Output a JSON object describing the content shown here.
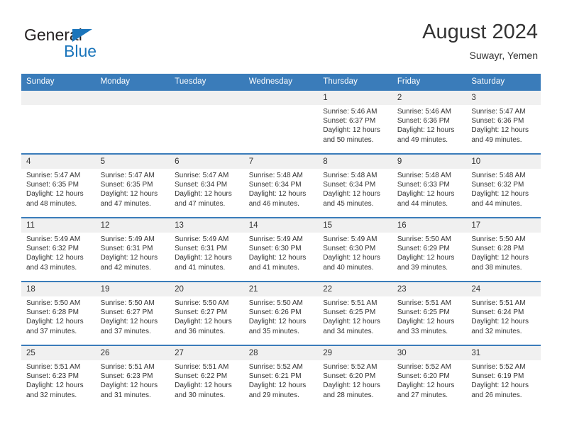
{
  "brand": {
    "name_top": "General",
    "name_bottom": "Blue",
    "color_blue": "#1b75bb",
    "color_dark": "#231f20"
  },
  "header": {
    "title": "August 2024",
    "subtitle": "Suwayr, Yemen"
  },
  "theme": {
    "header_row_bg": "#3a7cba",
    "daynum_bg": "#f0f0f0",
    "text": "#333333"
  },
  "weekday_headers": [
    "Sunday",
    "Monday",
    "Tuesday",
    "Wednesday",
    "Thursday",
    "Friday",
    "Saturday"
  ],
  "labels": {
    "sunrise_prefix": "Sunrise:",
    "sunset_prefix": "Sunset:",
    "daylight_prefix": "Daylight:"
  },
  "weeks": [
    [
      {
        "day": "",
        "empty": true
      },
      {
        "day": "",
        "empty": true
      },
      {
        "day": "",
        "empty": true
      },
      {
        "day": "",
        "empty": true
      },
      {
        "day": "1",
        "sunrise": "Sunrise: 5:46 AM",
        "sunset": "Sunset: 6:37 PM",
        "daylight": "Daylight: 12 hours and 50 minutes."
      },
      {
        "day": "2",
        "sunrise": "Sunrise: 5:46 AM",
        "sunset": "Sunset: 6:36 PM",
        "daylight": "Daylight: 12 hours and 49 minutes."
      },
      {
        "day": "3",
        "sunrise": "Sunrise: 5:47 AM",
        "sunset": "Sunset: 6:36 PM",
        "daylight": "Daylight: 12 hours and 49 minutes."
      }
    ],
    [
      {
        "day": "4",
        "sunrise": "Sunrise: 5:47 AM",
        "sunset": "Sunset: 6:35 PM",
        "daylight": "Daylight: 12 hours and 48 minutes."
      },
      {
        "day": "5",
        "sunrise": "Sunrise: 5:47 AM",
        "sunset": "Sunset: 6:35 PM",
        "daylight": "Daylight: 12 hours and 47 minutes."
      },
      {
        "day": "6",
        "sunrise": "Sunrise: 5:47 AM",
        "sunset": "Sunset: 6:34 PM",
        "daylight": "Daylight: 12 hours and 47 minutes."
      },
      {
        "day": "7",
        "sunrise": "Sunrise: 5:48 AM",
        "sunset": "Sunset: 6:34 PM",
        "daylight": "Daylight: 12 hours and 46 minutes."
      },
      {
        "day": "8",
        "sunrise": "Sunrise: 5:48 AM",
        "sunset": "Sunset: 6:34 PM",
        "daylight": "Daylight: 12 hours and 45 minutes."
      },
      {
        "day": "9",
        "sunrise": "Sunrise: 5:48 AM",
        "sunset": "Sunset: 6:33 PM",
        "daylight": "Daylight: 12 hours and 44 minutes."
      },
      {
        "day": "10",
        "sunrise": "Sunrise: 5:48 AM",
        "sunset": "Sunset: 6:32 PM",
        "daylight": "Daylight: 12 hours and 44 minutes."
      }
    ],
    [
      {
        "day": "11",
        "sunrise": "Sunrise: 5:49 AM",
        "sunset": "Sunset: 6:32 PM",
        "daylight": "Daylight: 12 hours and 43 minutes."
      },
      {
        "day": "12",
        "sunrise": "Sunrise: 5:49 AM",
        "sunset": "Sunset: 6:31 PM",
        "daylight": "Daylight: 12 hours and 42 minutes."
      },
      {
        "day": "13",
        "sunrise": "Sunrise: 5:49 AM",
        "sunset": "Sunset: 6:31 PM",
        "daylight": "Daylight: 12 hours and 41 minutes."
      },
      {
        "day": "14",
        "sunrise": "Sunrise: 5:49 AM",
        "sunset": "Sunset: 6:30 PM",
        "daylight": "Daylight: 12 hours and 41 minutes."
      },
      {
        "day": "15",
        "sunrise": "Sunrise: 5:49 AM",
        "sunset": "Sunset: 6:30 PM",
        "daylight": "Daylight: 12 hours and 40 minutes."
      },
      {
        "day": "16",
        "sunrise": "Sunrise: 5:50 AM",
        "sunset": "Sunset: 6:29 PM",
        "daylight": "Daylight: 12 hours and 39 minutes."
      },
      {
        "day": "17",
        "sunrise": "Sunrise: 5:50 AM",
        "sunset": "Sunset: 6:28 PM",
        "daylight": "Daylight: 12 hours and 38 minutes."
      }
    ],
    [
      {
        "day": "18",
        "sunrise": "Sunrise: 5:50 AM",
        "sunset": "Sunset: 6:28 PM",
        "daylight": "Daylight: 12 hours and 37 minutes."
      },
      {
        "day": "19",
        "sunrise": "Sunrise: 5:50 AM",
        "sunset": "Sunset: 6:27 PM",
        "daylight": "Daylight: 12 hours and 37 minutes."
      },
      {
        "day": "20",
        "sunrise": "Sunrise: 5:50 AM",
        "sunset": "Sunset: 6:27 PM",
        "daylight": "Daylight: 12 hours and 36 minutes."
      },
      {
        "day": "21",
        "sunrise": "Sunrise: 5:50 AM",
        "sunset": "Sunset: 6:26 PM",
        "daylight": "Daylight: 12 hours and 35 minutes."
      },
      {
        "day": "22",
        "sunrise": "Sunrise: 5:51 AM",
        "sunset": "Sunset: 6:25 PM",
        "daylight": "Daylight: 12 hours and 34 minutes."
      },
      {
        "day": "23",
        "sunrise": "Sunrise: 5:51 AM",
        "sunset": "Sunset: 6:25 PM",
        "daylight": "Daylight: 12 hours and 33 minutes."
      },
      {
        "day": "24",
        "sunrise": "Sunrise: 5:51 AM",
        "sunset": "Sunset: 6:24 PM",
        "daylight": "Daylight: 12 hours and 32 minutes."
      }
    ],
    [
      {
        "day": "25",
        "sunrise": "Sunrise: 5:51 AM",
        "sunset": "Sunset: 6:23 PM",
        "daylight": "Daylight: 12 hours and 32 minutes."
      },
      {
        "day": "26",
        "sunrise": "Sunrise: 5:51 AM",
        "sunset": "Sunset: 6:23 PM",
        "daylight": "Daylight: 12 hours and 31 minutes."
      },
      {
        "day": "27",
        "sunrise": "Sunrise: 5:51 AM",
        "sunset": "Sunset: 6:22 PM",
        "daylight": "Daylight: 12 hours and 30 minutes."
      },
      {
        "day": "28",
        "sunrise": "Sunrise: 5:52 AM",
        "sunset": "Sunset: 6:21 PM",
        "daylight": "Daylight: 12 hours and 29 minutes."
      },
      {
        "day": "29",
        "sunrise": "Sunrise: 5:52 AM",
        "sunset": "Sunset: 6:20 PM",
        "daylight": "Daylight: 12 hours and 28 minutes."
      },
      {
        "day": "30",
        "sunrise": "Sunrise: 5:52 AM",
        "sunset": "Sunset: 6:20 PM",
        "daylight": "Daylight: 12 hours and 27 minutes."
      },
      {
        "day": "31",
        "sunrise": "Sunrise: 5:52 AM",
        "sunset": "Sunset: 6:19 PM",
        "daylight": "Daylight: 12 hours and 26 minutes."
      }
    ]
  ]
}
